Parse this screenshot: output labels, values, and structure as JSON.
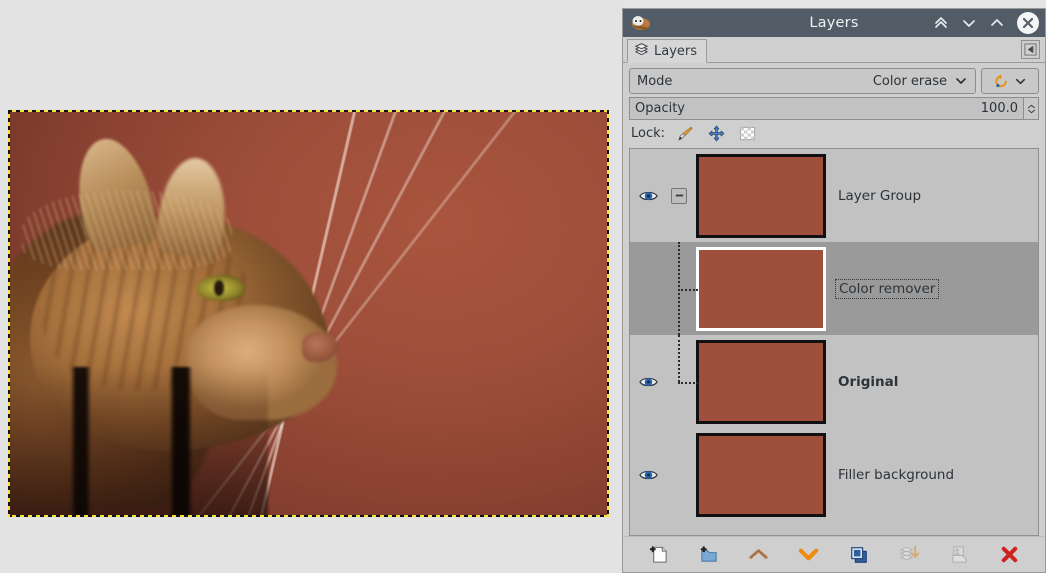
{
  "window": {
    "title": "Layers",
    "app_icon": "gimp-wilber-icon",
    "controls": [
      {
        "name": "collapse-all-button",
        "icon": "double-chevron-up-icon"
      },
      {
        "name": "minimize-button",
        "icon": "chevron-down-icon"
      },
      {
        "name": "maximize-button",
        "icon": "chevron-up-icon"
      },
      {
        "name": "close-button",
        "icon": "close-x-icon"
      }
    ]
  },
  "tab": {
    "label": "Layers",
    "icon": "layers-stack-icon",
    "menu_button_icon": "tab-menu-triangle-icon"
  },
  "controls": {
    "mode_label": "Mode",
    "mode_value": "Color erase",
    "mode_dropdown_icon": "chevron-down-icon",
    "blend_space_icon": "reset-revert-icon",
    "blend_space_dropdown_icon": "chevron-down-icon",
    "opacity_label": "Opacity",
    "opacity_value": "100.0",
    "lock_label": "Lock:",
    "lock_buttons": [
      {
        "name": "lock-pixels-button",
        "icon": "paintbrush-icon"
      },
      {
        "name": "lock-position-button",
        "icon": "move-cross-icon"
      },
      {
        "name": "lock-alpha-button",
        "icon": "checkerboard-icon"
      }
    ]
  },
  "layers": [
    {
      "name": "Layer Group",
      "visible": true,
      "selected": false,
      "bold": false,
      "indent": 0,
      "is_group": true,
      "expander_icon": "collapse-minus-icon",
      "thumb": "photo",
      "eye_icon": "eye-icon"
    },
    {
      "name": "Color remover",
      "visible": false,
      "selected": true,
      "bold": false,
      "indent": 1,
      "is_group": false,
      "thumb": "flat-color",
      "eye_icon": ""
    },
    {
      "name": "Original",
      "visible": true,
      "selected": false,
      "bold": true,
      "indent": 1,
      "is_group": false,
      "thumb": "photo",
      "eye_icon": "eye-icon"
    },
    {
      "name": "Filler background",
      "visible": true,
      "selected": false,
      "bold": false,
      "indent": 0,
      "is_group": false,
      "thumb": "flat-color",
      "eye_icon": "eye-icon"
    }
  ],
  "toolbar": [
    {
      "name": "new-layer-button",
      "icon": "new-layer-icon",
      "enabled": true
    },
    {
      "name": "new-layer-group-button",
      "icon": "new-layer-group-icon",
      "enabled": true
    },
    {
      "name": "raise-layer-button",
      "icon": "chevron-up-icon",
      "enabled": true
    },
    {
      "name": "lower-layer-button",
      "icon": "chevron-down-icon",
      "enabled": true
    },
    {
      "name": "duplicate-layer-button",
      "icon": "duplicate-layer-icon",
      "enabled": true
    },
    {
      "name": "merge-down-button",
      "icon": "merge-down-icon",
      "enabled": false
    },
    {
      "name": "anchor-layer-button",
      "icon": "anchor-layer-icon",
      "enabled": false
    },
    {
      "name": "delete-layer-button",
      "icon": "delete-x-icon",
      "enabled": true
    }
  ],
  "canvas": {
    "image_description": "ginger-cat-profile-photo",
    "selection": "marching-ants-select-all",
    "background_color": "#9e503c"
  },
  "colors": {
    "titlebar": "#525c66",
    "dialog_bg": "#cfcfcf",
    "list_bg": "#c2c2c2",
    "selected_row": "#9a9a9a",
    "layer_flat_color": "#9e503c",
    "delete_red": "#cc2222",
    "accent_orange": "#e8941c",
    "eye_blue": "#2b63a8"
  }
}
